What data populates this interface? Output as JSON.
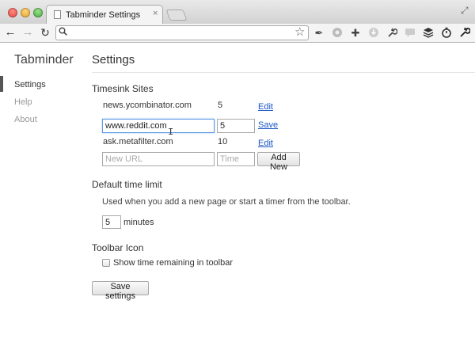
{
  "browser": {
    "tab_title": "Tabminder Settings",
    "tab_close": "×",
    "nav_back": "←",
    "nav_forward": "→",
    "nav_reload": "↻",
    "omnibox_value": "",
    "extension_icons": [
      "bookmark-pin-icon",
      "globe-icon",
      "medical-cross-icon",
      "download-icon",
      "wrench-icon",
      "speech-bubble-icon",
      "layers-icon",
      "timer-icon",
      "settings-wrench-icon"
    ]
  },
  "sidebar": {
    "brand": "Tabminder",
    "items": [
      {
        "label": "Settings",
        "active": true
      },
      {
        "label": "Help",
        "active": false
      },
      {
        "label": "About",
        "active": false
      }
    ]
  },
  "main": {
    "title": "Settings",
    "timesink": {
      "heading": "Timesink Sites",
      "rows": [
        {
          "url": "news.ycombinator.com",
          "time": "5",
          "action": "Edit"
        },
        {
          "url": "www.reddit.com",
          "time": "5",
          "action": "Save",
          "editing": true
        },
        {
          "url": "ask.metafilter.com",
          "time": "10",
          "action": "Edit"
        }
      ],
      "new_url_placeholder": "New URL",
      "new_time_placeholder": "Time",
      "add_button": "Add New"
    },
    "default_limit": {
      "heading": "Default time limit",
      "description": "Used when you add a new page or start a timer from the toolbar.",
      "value": "5",
      "unit": "minutes"
    },
    "toolbar_icon": {
      "heading": "Toolbar Icon",
      "checkbox_label": "Show time remaining in toolbar",
      "checked": false
    },
    "save_button": "Save settings"
  }
}
